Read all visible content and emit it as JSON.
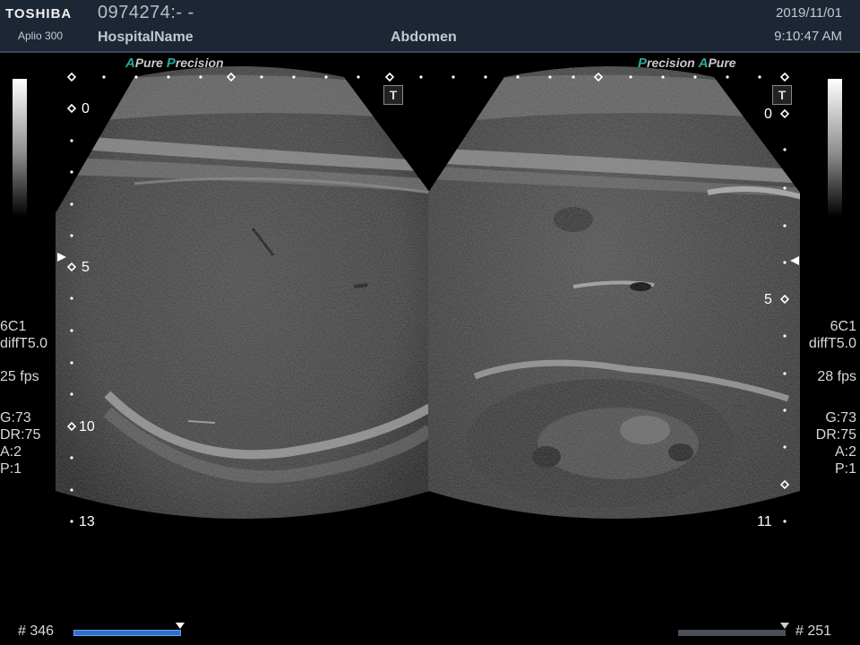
{
  "header": {
    "brand": "TOSHIBA",
    "model": "Aplio 300",
    "patient_id": "0974274:- -",
    "hospital": "HospitalName",
    "preset": "Abdomen",
    "date": "2019/11/01",
    "time": "9:10:47 AM"
  },
  "left_image": {
    "features": {
      "a1": "A",
      "w1": "Pure",
      "p": "P",
      "w2": "recision"
    },
    "depth_labels": [
      "0",
      "5",
      "10",
      "13"
    ],
    "probe": "6C1",
    "mode": "diffT5.0",
    "fps": "25 fps",
    "gain": "G:73",
    "dynamic_range": "DR:75",
    "a": "A:2",
    "p": "P:1",
    "cine_frames": "# 346",
    "cine_progress": 1.0,
    "t_marker": "T"
  },
  "right_image": {
    "features": {
      "p": "P",
      "w1": "recision",
      "a1": "A",
      "w2": "Pure"
    },
    "depth_labels": [
      "0",
      "5",
      "11"
    ],
    "probe": "6C1",
    "mode": "diffT5.0",
    "fps": "28 fps",
    "gain": "G:73",
    "dynamic_range": "DR:75",
    "a": "A:2",
    "p": "P:1",
    "cine_frames": "# 251",
    "cine_progress": 1.0,
    "t_marker": "T"
  },
  "colors": {
    "header_bg": "#1d2634",
    "accent_teal": "#2aa8a0",
    "cine_bar_left": "#2f6fc9",
    "cine_bar_right": "#4a4e55"
  }
}
